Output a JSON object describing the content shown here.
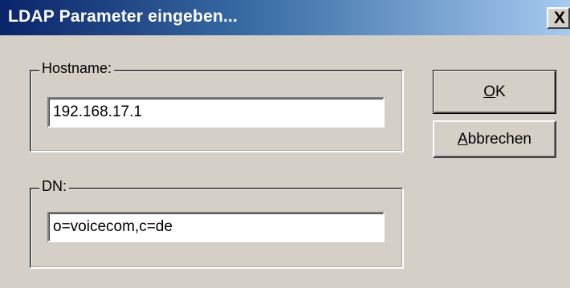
{
  "window": {
    "title": "LDAP Parameter eingeben...",
    "close_glyph": "X"
  },
  "hostname": {
    "label": "Hostname:",
    "value": "192.168.17.1"
  },
  "dn": {
    "label": "DN:",
    "value": "o=voicecom,c=de"
  },
  "buttons": {
    "ok": {
      "mnemonic": "O",
      "rest": "K"
    },
    "cancel": {
      "mnemonic": "A",
      "rest": "bbrechen"
    }
  },
  "colors": {
    "face": "#d4d0c8",
    "title_start": "#0a246a",
    "title_end": "#a6caf0"
  }
}
